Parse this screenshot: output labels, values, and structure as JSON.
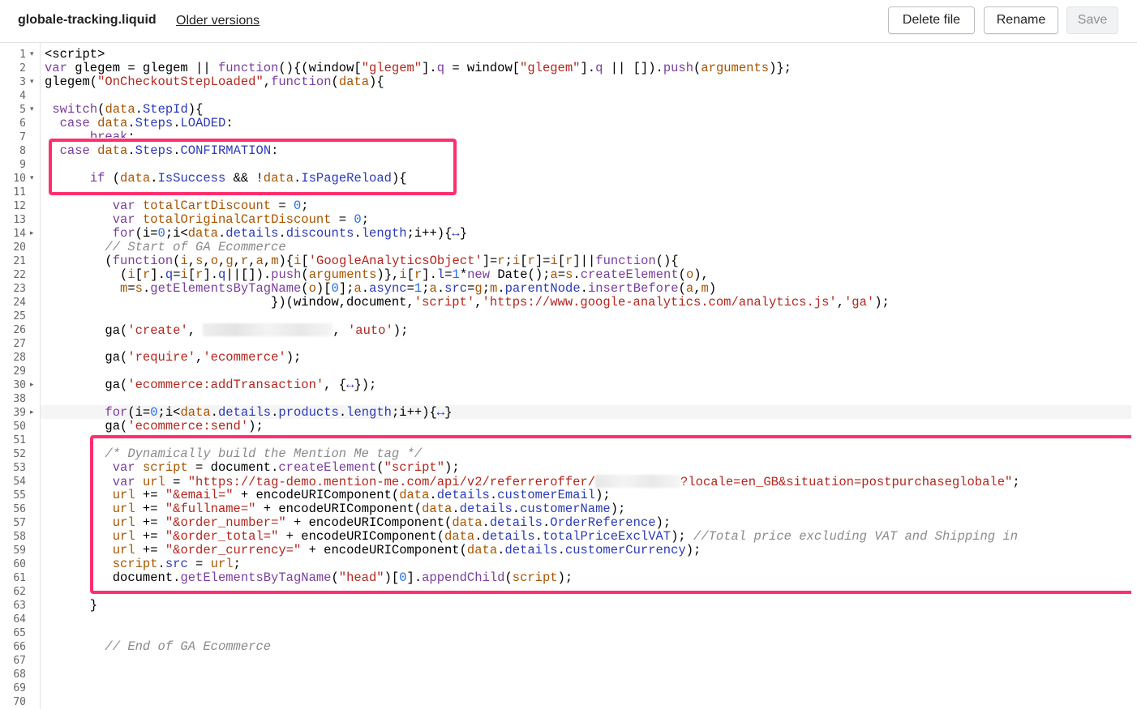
{
  "header": {
    "filename": "globale-tracking.liquid",
    "older_versions": "Older versions",
    "delete_label": "Delete file",
    "rename_label": "Rename",
    "save_label": "Save"
  },
  "editor": {
    "line_numbers": [
      "1",
      "2",
      "3",
      "4",
      "5",
      "6",
      "7",
      "8",
      "9",
      "10",
      "11",
      "12",
      "13",
      "14",
      "20",
      "21",
      "22",
      "23",
      "24",
      "25",
      "26",
      "27",
      "28",
      "29",
      "30",
      "38",
      "39",
      "50",
      "51",
      "52",
      "53",
      "54",
      "55",
      "56",
      "57",
      "58",
      "59",
      "60",
      "61",
      "62",
      "63",
      "64",
      "65",
      "66",
      "67",
      "68",
      "69",
      "70"
    ],
    "fold_markers": {
      "1": "▾",
      "3": "▾",
      "5": "▾",
      "10": "▾",
      "14": "▸",
      "30": "▸",
      "39": "▸"
    },
    "highlight_color": "#ff2f6f"
  }
}
